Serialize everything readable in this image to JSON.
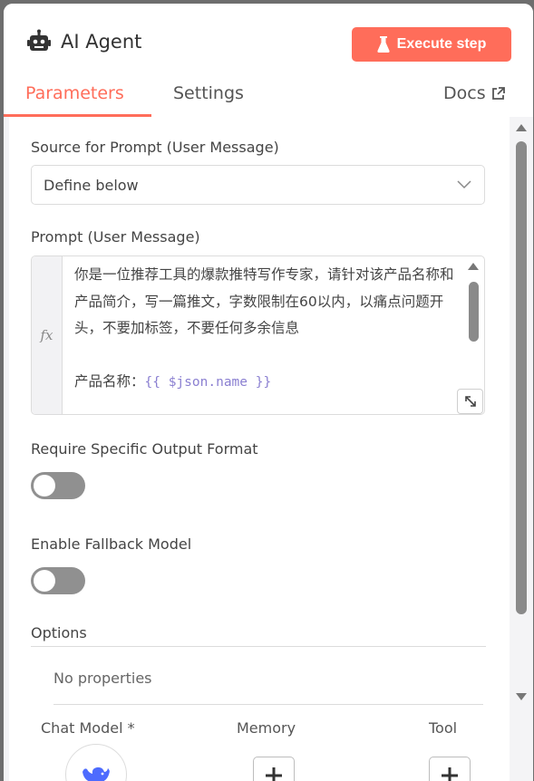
{
  "header": {
    "title": "AI Agent",
    "execute_label": "Execute step",
    "accent_color": "#ff6d5a"
  },
  "tabs": [
    {
      "label": "Parameters",
      "active": true
    },
    {
      "label": "Settings",
      "active": false
    }
  ],
  "docs_label": "Docs",
  "form": {
    "source_label": "Source for Prompt (User Message)",
    "source_value": "Define below",
    "prompt_label": "Prompt (User Message)",
    "prompt_fx": "fx",
    "prompt_text": "你是一位推荐工具的爆款推特写作专家，请针对该产品名称和产品简介，写一篇推文，字数限制在60以内，以痛点问题开头，不要加标签，不要任何多余信息",
    "prompt_line2_prefix": "产品名称：",
    "prompt_expr": "{{ $json.name }}",
    "output_format_label": "Require Specific Output Format",
    "output_format_enabled": false,
    "fallback_label": "Enable Fallback Model",
    "fallback_enabled": false,
    "options_label": "Options",
    "no_properties": "No properties"
  },
  "connections": {
    "chat_model": "Chat Model *",
    "memory": "Memory",
    "tool": "Tool"
  },
  "icons": {
    "title": "robot-icon",
    "execute": "flask-icon",
    "docs": "external-link-icon",
    "select": "chevron-down-icon",
    "expand": "expand-icon",
    "chat_model": "deepseek-whale-icon",
    "add": "plus-icon"
  }
}
